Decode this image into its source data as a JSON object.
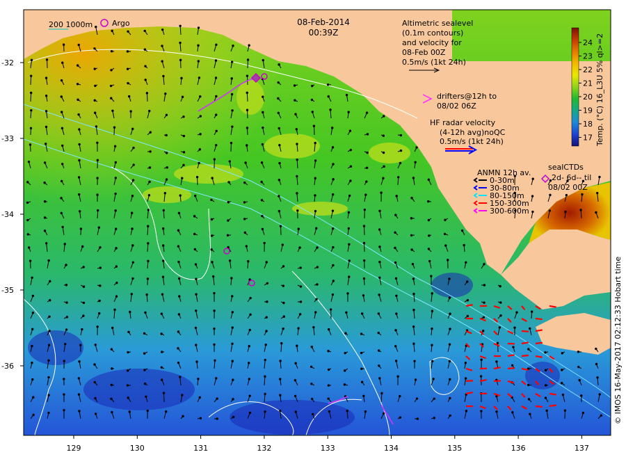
{
  "map": {
    "date": "08-Feb-2014",
    "time": "00:39Z",
    "lon_ticks": [
      "129",
      "130",
      "131",
      "132",
      "133",
      "134",
      "135",
      "136",
      "137"
    ],
    "lat_ticks": [
      "-32",
      "-33",
      "-34",
      "-35",
      "-36"
    ],
    "land_color": "#f8c89c"
  },
  "legend": {
    "bathy_label": "200  1000m",
    "argo_label": "Argo",
    "altimetry_lines": [
      "Altimetric sealevel",
      "(0.1m contours)",
      "and velocity for",
      "08-Feb 00Z",
      "0.5m/s (1kt 24h)"
    ],
    "drifters_lines": [
      "drifters@12h to",
      "08/02 06Z"
    ],
    "hf_radar_lines": [
      "HF radar velocity",
      "(4-12h avg)noQC",
      "0.5m/s (1kt 24h)"
    ],
    "anmn_title": "ANMN 12h av.",
    "anmn_items": [
      {
        "label": "0-30m",
        "color": "#000000"
      },
      {
        "label": "30-80m",
        "color": "#0000ff"
      },
      {
        "label": "80-150m",
        "color": "#00e5ff"
      },
      {
        "label": "150-300m",
        "color": "#ff0000"
      },
      {
        "label": "300-600m",
        "color": "#ff00ff"
      }
    ],
    "sealctd_lines": [
      "sealCTDs",
      "2d- 6d-- til",
      "08/02 00Z"
    ]
  },
  "colorbar": {
    "ticks": [
      "24",
      "23",
      "22",
      "21",
      "20",
      "19",
      "18",
      "17"
    ],
    "title": "Temp. (°C) 16_L3U 5% ql>=2",
    "colors": [
      "#7a1400",
      "#c43a00",
      "#e67a00",
      "#f2b800",
      "#e8e800",
      "#a8dc1a",
      "#39c21e",
      "#13b04c",
      "#16a8a0",
      "#1e7fd8",
      "#1e3cd0",
      "#1a1a8a"
    ]
  },
  "credit": "© IMOS 16-May-2017 02:12:33 Hobart time"
}
